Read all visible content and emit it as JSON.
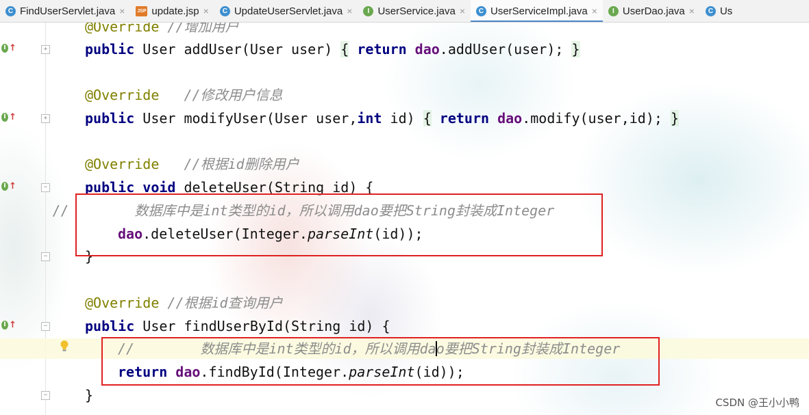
{
  "tabs": [
    {
      "label": "FindUserServlet.java",
      "icon": "class-icon",
      "active": false
    },
    {
      "label": "update.jsp",
      "icon": "jsp-icon",
      "active": false
    },
    {
      "label": "UpdateUserServlet.java",
      "icon": "class-icon",
      "active": false
    },
    {
      "label": "UserService.java",
      "icon": "interface-icon",
      "active": false
    },
    {
      "label": "UserServiceImpl.java",
      "icon": "class-icon",
      "active": true
    },
    {
      "label": "UserDao.java",
      "icon": "interface-icon",
      "active": false
    },
    {
      "label": "Us",
      "icon": "class-icon",
      "active": false
    }
  ],
  "icon_letters": {
    "class": "C",
    "interface": "I",
    "jsp": "JSP"
  },
  "code": {
    "l0": {
      "ann": "@Override",
      "cmt": "//增加用户"
    },
    "l1": {
      "kw1": "public",
      "t1": " User addUser(User user) ",
      "ob": "{",
      "t2": " ",
      "kw2": "return",
      "t3": " ",
      "fld": "dao",
      "t4": ".addUser(user); ",
      "cb": "}"
    },
    "l3": {
      "ann": "@Override",
      "cmt": "   //修改用户信息"
    },
    "l4": {
      "kw1": "public",
      "t1": " User modifyUser(User user,",
      "kw2": "int",
      "t2": " id) ",
      "ob": "{",
      "t3": " ",
      "kw3": "return",
      "t4": " ",
      "fld": "dao",
      "t5": ".modify(user,id); ",
      "cb": "}"
    },
    "l6": {
      "ann": "@Override",
      "cmt": "   //根据id删除用户"
    },
    "l7": {
      "kw1": "public",
      "kw2": "void",
      "t1": " deleteUser(String id) {"
    },
    "l8": {
      "prefix": "//",
      "cmt": "        数据库中是int类型的id，所以调用dao要把String封装成Integer"
    },
    "l9": {
      "fld": "dao",
      "t1": ".deleteUser(Integer.",
      "ital": "parseInt",
      "t2": "(id));"
    },
    "l10": {
      "t": "}"
    },
    "l12": {
      "ann": "@Override",
      "cmt": " //根据id查询用户"
    },
    "l13": {
      "kw1": "public",
      "t1": " User findUserById(String id) {"
    },
    "l14": {
      "cmt_a": "//        数据库中是int类型的id，所以调用da",
      "cmt_b": "o要把String封装成Integer"
    },
    "l15": {
      "kw": "return",
      "fld": "dao",
      "t1": ".findById(Integer.",
      "ital": "parseInt",
      "t2": "(id));"
    },
    "l16": {
      "t": "}"
    }
  },
  "watermark": "CSDN @王小小鸭",
  "colors": {
    "keyword": "#000080",
    "annotation": "#808000",
    "field": "#660e7a",
    "comment": "#8c8c8c",
    "highlight_box": "#e02020"
  }
}
